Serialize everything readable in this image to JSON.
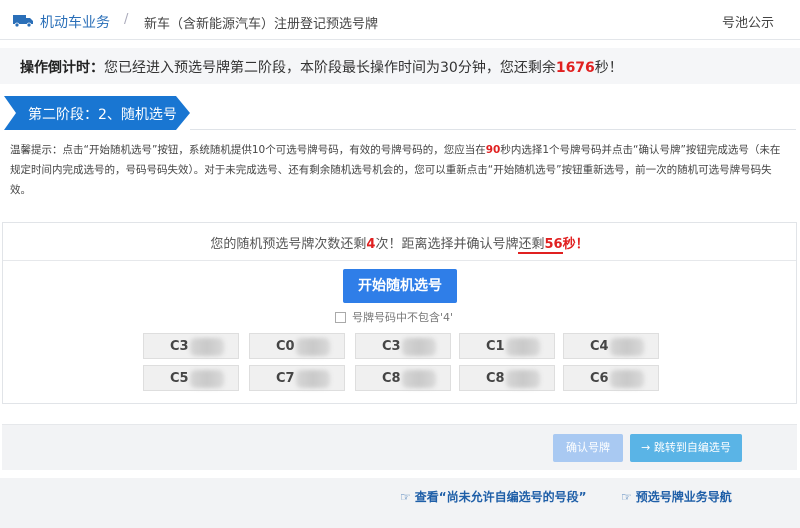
{
  "header": {
    "section": "机动车业务",
    "separator": "/",
    "breadcrumb": "新车（含新能源汽车）注册登记预选号牌",
    "pool_link": "号池公示",
    "icon": "car-icon"
  },
  "countdown": {
    "title": "操作倒计时：",
    "text_before": "您已经进入预选号牌第二阶段，本阶段最长操作时间为30分钟，您还剩余",
    "seconds": "1676",
    "text_after": "秒！"
  },
  "stage": {
    "label": "第二阶段：2、随机选号"
  },
  "tips": {
    "part1": "温馨提示：点击“开始随机选号”按钮，系统随机提供10个可选号牌号码，有效的号牌号码的，您应当在",
    "highlight": "90",
    "part2": "秒内选择1个号牌号码并点击“确认号牌”按钮完成选号（未在规定时间内完成选号的，号码号码失效）。对于未完成选号、还有剩余随机选号机会的，您可以重新点击“开始随机选号”按钮重新选号，前一次的随机可选号牌号码失效。"
  },
  "selection": {
    "msg_before": "您的随机预选号牌次数还剩",
    "remaining": "4",
    "msg_middle": "次！距离选择并确认号牌",
    "msg_underlined": "还剩",
    "seconds": "56",
    "msg_after": "秒！",
    "start_button": "开始随机选号",
    "exclude_label": "号牌号码中不包含'4'",
    "plates": [
      "C3",
      "C0",
      "C3",
      "C1",
      "C4",
      "C5",
      "C7",
      "C8",
      "C8",
      "C6"
    ]
  },
  "actions": {
    "confirm": "确认号牌",
    "switch": "→ 跳转到自编选号"
  },
  "footer": {
    "link1": "查看“尚未允许自编选号的号段”",
    "link2": "预选号牌业务导航",
    "hand_icon": "pointing-hand-icon"
  },
  "colors": {
    "accent": "#1976d2",
    "start_button": "#2f7ee8",
    "confirm_disabled": "#a9c9f2",
    "switch_button": "#5ab4e6",
    "highlight_red": "#e02020",
    "link": "#1f5fa8"
  }
}
